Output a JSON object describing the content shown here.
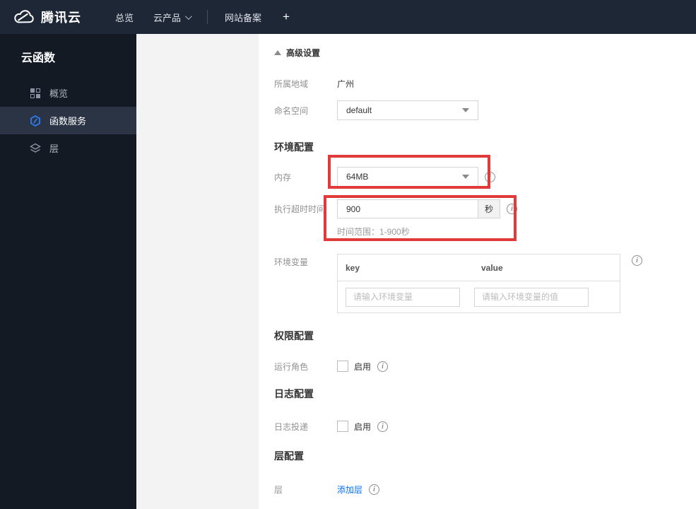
{
  "topbar": {
    "brand": "腾讯云",
    "nav": [
      {
        "label": "总览",
        "has_caret": false
      },
      {
        "label": "云产品",
        "has_caret": true
      },
      {
        "label": "网站备案",
        "has_caret": false
      }
    ],
    "plus_label": "+"
  },
  "sidebar": {
    "title": "云函数",
    "items": [
      {
        "label": "概览",
        "icon": "grid-icon",
        "active": false
      },
      {
        "label": "函数服务",
        "icon": "function-icon",
        "active": true
      },
      {
        "label": "层",
        "icon": "layers-icon",
        "active": false
      }
    ]
  },
  "main": {
    "advanced_toggle": {
      "label": "高级设置"
    },
    "sections": {
      "env": "环境配置",
      "perm": "权限配置",
      "logs": "日志配置",
      "layers": "层配置"
    },
    "fields": {
      "region": {
        "label": "所属地域",
        "value": "广州"
      },
      "namespace": {
        "label": "命名空间",
        "value": "default"
      },
      "memory": {
        "label": "内存",
        "value": "64MB"
      },
      "timeout": {
        "label": "执行超时时间",
        "value": "900",
        "unit": "秒",
        "hint": "时间范围：1-900秒"
      },
      "env_vars": {
        "label": "环境变量",
        "key_header": "key",
        "value_header": "value",
        "key_placeholder": "请输入环境变量",
        "value_placeholder": "请输入环境变量的值"
      },
      "role": {
        "label": "运行角色",
        "checkbox_label": "启用"
      },
      "log_delivery": {
        "label": "日志投递",
        "checkbox_label": "启用"
      },
      "layer": {
        "label": "层",
        "link_label": "添加层"
      }
    },
    "info_glyph": "i",
    "colors": {
      "highlight_box": "#e03a3a",
      "link": "#006eff",
      "accent_blue": "#2b7df0",
      "topbar_bg": "#1e2736",
      "sidebar_bg": "#141a23"
    }
  }
}
